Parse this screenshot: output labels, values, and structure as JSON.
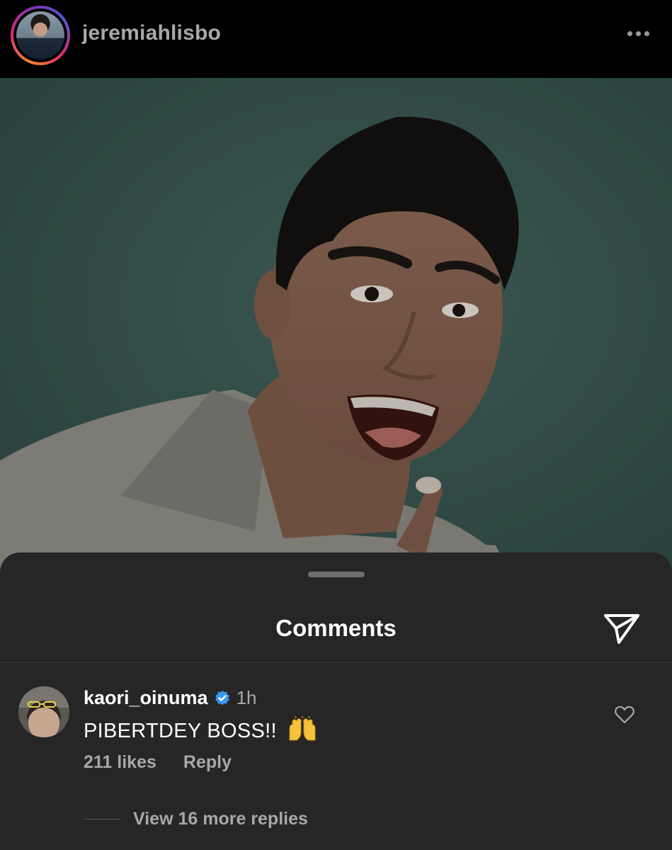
{
  "header": {
    "username": "jeremiahlisbo",
    "avatar_icon": "profile-avatar",
    "more_icon": "more-options-icon"
  },
  "post": {
    "image_icon": "post-photo"
  },
  "comments_sheet": {
    "title": "Comments",
    "share_icon": "send-icon",
    "comments": [
      {
        "username": "kaori_oinuma",
        "verified": true,
        "time": "1h",
        "text": "PIBERTDEY BOSS!!",
        "emoji": "raising-hands",
        "likes": "211 likes",
        "reply_label": "Reply",
        "view_replies": "View 16 more replies"
      }
    ]
  },
  "colors": {
    "sheet_bg": "#262626",
    "header_bg": "#000000",
    "muted_text": "#a8a8a8",
    "verified_blue": "#3897f0",
    "photo_bg": "#3a5852"
  }
}
